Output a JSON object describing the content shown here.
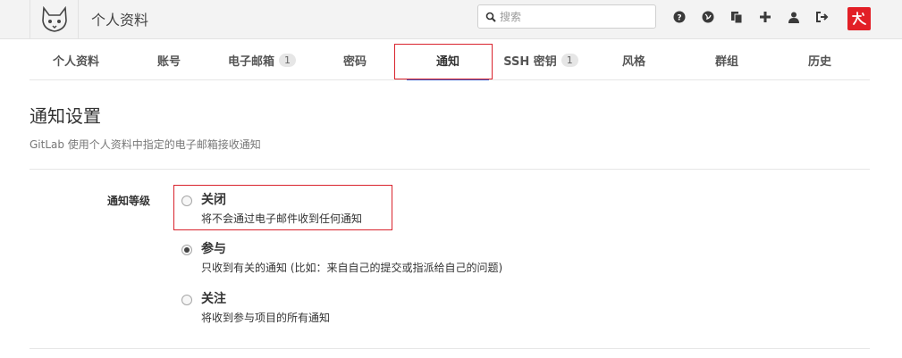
{
  "header": {
    "title": "个人资料",
    "search_placeholder": "搜索",
    "icons": [
      "help-icon",
      "globe-icon",
      "copy-icon",
      "plus-icon",
      "user-icon",
      "sign-out-icon"
    ]
  },
  "tabs": [
    {
      "label": "个人资料",
      "badge": ""
    },
    {
      "label": "账号",
      "badge": ""
    },
    {
      "label": "电子邮箱",
      "badge": "1"
    },
    {
      "label": "密码",
      "badge": ""
    },
    {
      "label": "通知",
      "badge": "",
      "active": true
    },
    {
      "label": "SSH 密钥",
      "badge": "1"
    },
    {
      "label": "风格",
      "badge": ""
    },
    {
      "label": "群组",
      "badge": ""
    },
    {
      "label": "历史",
      "badge": ""
    }
  ],
  "main": {
    "title": "通知设置",
    "subtitle": "GitLab 使用个人资料中指定的电子邮箱接收通知",
    "level_label": "通知等级",
    "options": [
      {
        "title": "关闭",
        "desc": "将不会通过电子邮件收到任何通知",
        "checked": false
      },
      {
        "title": "参与",
        "desc": "只收到有关的通知 (比如：来自自己的提交或指派给自己的问题)",
        "checked": true
      },
      {
        "title": "关注",
        "desc": "将收到参与项目的所有通知",
        "checked": false
      }
    ]
  },
  "colors": {
    "accent": "#3a5fcd",
    "highlight": "#d9232d",
    "avatar_bg": "#e21f26"
  }
}
